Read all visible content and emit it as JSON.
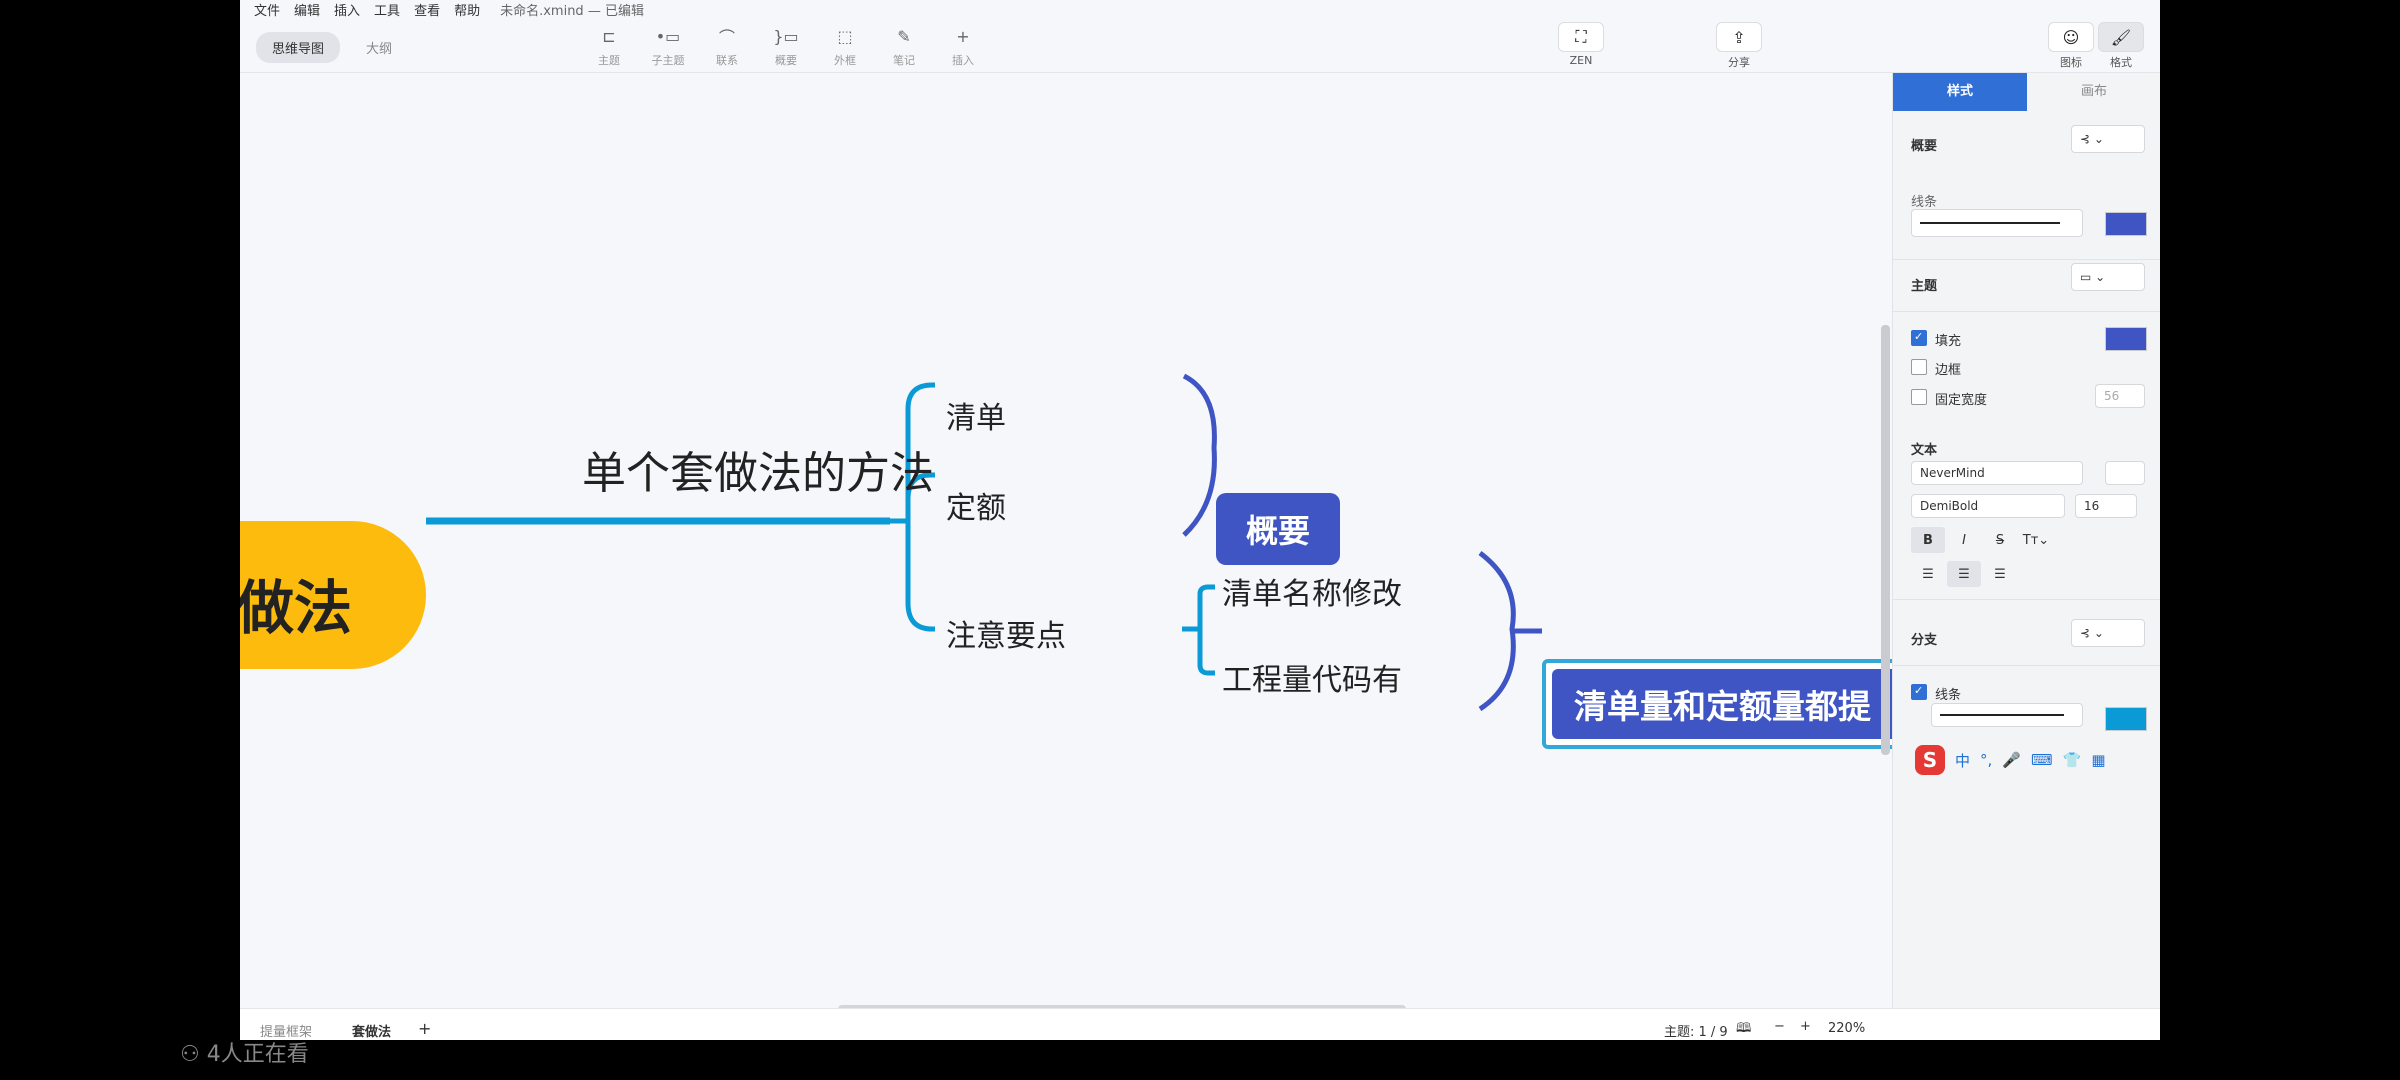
{
  "menubar": {
    "items": [
      "文件",
      "编辑",
      "插入",
      "工具",
      "查看",
      "帮助"
    ],
    "title": "未命名.xmind — 已编辑"
  },
  "view_tabs": [
    "思维导图",
    "大纲"
  ],
  "toolbar": {
    "topic": "主题",
    "subtopic": "子主题",
    "relation": "联系",
    "summary": "概要",
    "boundary": "外框",
    "note": "笔记",
    "insert": "插入",
    "zen": "ZEN",
    "share": "分享",
    "icon": "图标",
    "format": "格式"
  },
  "mindmap": {
    "root": "做法",
    "main_topic": "单个套做法的方法",
    "branches": [
      "清单",
      "定额",
      "注意要点"
    ],
    "summary": "概要",
    "subbranches": [
      "清单名称修改",
      "工程量代码有"
    ],
    "note_summary": "清单量和定额量都提"
  },
  "panel": {
    "tab_style": "样式",
    "tab_canvas": "画布",
    "summary_heading": "概要",
    "line_label": "线条",
    "topic_heading": "主题",
    "fill": "填充",
    "border": "边框",
    "fixed_width": "固定宽度",
    "fixed_width_value": "56",
    "text_heading": "文本",
    "font_family": "NeverMind",
    "font_weight": "DemiBold",
    "font_size": "16",
    "branch_heading": "分支",
    "branch_line": "线条",
    "colors": {
      "accent": "#3f55c4",
      "branch": "#0a9ad6",
      "root": "#fdbb0d"
    }
  },
  "statusbar": {
    "sheet1": "提量框架",
    "sheet2": "套做法",
    "add": "+",
    "topic_count": "主题: 1 / 9",
    "zoom": "220%"
  },
  "ime": {
    "brand": "S",
    "chars": [
      "中",
      "°,",
      "🎤",
      "⌨",
      "👕",
      "▦"
    ]
  },
  "viewers": "4人正在看"
}
